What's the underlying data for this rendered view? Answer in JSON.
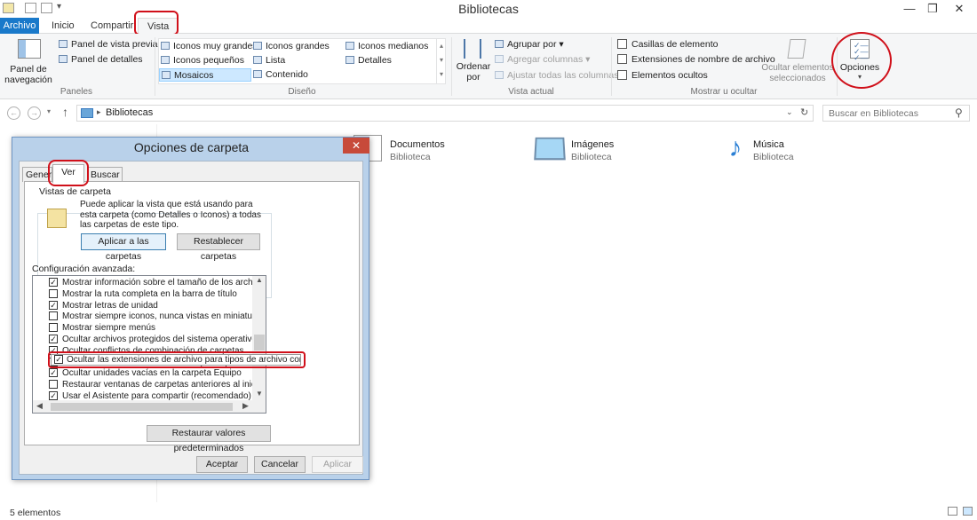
{
  "window": {
    "title": "Bibliotecas",
    "minimize": "—",
    "maximize": "❐",
    "close": "✕"
  },
  "tabs": [
    "Archivo",
    "Inicio",
    "Compartir",
    "Vista"
  ],
  "ribbon": {
    "panes": {
      "nav_pane": "Panel de navegación",
      "preview": "Panel de vista previa",
      "details": "Panel de detalles",
      "label": "Paneles"
    },
    "layout": {
      "items": [
        "Iconos muy grandes",
        "Iconos grandes",
        "Iconos medianos",
        "Iconos pequeños",
        "Lista",
        "Detalles",
        "Mosaicos",
        "Contenido"
      ],
      "label": "Diseño"
    },
    "current_view": {
      "sort_by": "Ordenar por",
      "group_by": "Agrupar por",
      "add_columns": "Agregar columnas",
      "fit_columns": "Ajustar todas las columnas",
      "label": "Vista actual"
    },
    "show_hide": {
      "item_checkboxes": "Casillas de elemento",
      "file_extensions": "Extensiones de nombre de archivo",
      "hidden_items": "Elementos ocultos",
      "hide_selected": "Ocultar elementos seleccionados",
      "label": "Mostrar u ocultar"
    },
    "options": "Opciones"
  },
  "address": {
    "path": "Bibliotecas",
    "search_placeholder": "Buscar en Bibliotecas"
  },
  "libraries": [
    {
      "name": "Documentos",
      "sub": "Biblioteca"
    },
    {
      "name": "Imágenes",
      "sub": "Biblioteca"
    },
    {
      "name": "Música",
      "sub": "Biblioteca"
    }
  ],
  "status": "5 elementos",
  "dialog": {
    "title": "Opciones de carpeta",
    "close": "✕",
    "tabs": [
      "General",
      "Ver",
      "Buscar"
    ],
    "folder_views": {
      "legend": "Vistas de carpeta",
      "description": "Puede aplicar la vista que está usando para esta carpeta (como Detalles o Iconos) a todas las carpetas de este tipo.",
      "apply": "Aplicar a las carpetas",
      "reset": "Restablecer carpetas"
    },
    "advanced_label": "Configuración avanzada:",
    "settings": [
      {
        "text": "Mostrar información sobre el tamaño de los archivos en su",
        "checked": true
      },
      {
        "text": "Mostrar la ruta completa en la barra de título",
        "checked": false
      },
      {
        "text": "Mostrar letras de unidad",
        "checked": true
      },
      {
        "text": "Mostrar siempre iconos, nunca vistas en miniatura",
        "checked": false
      },
      {
        "text": "Mostrar siempre menús",
        "checked": false
      },
      {
        "text": "Ocultar archivos protegidos del sistema operativo (recome",
        "checked": true
      },
      {
        "text": "Ocultar conflictos de combinación de carpetas",
        "checked": true
      },
      {
        "text": "Ocultar las extensiones de archivo para tipos de archivo conocidos",
        "checked": true
      },
      {
        "text": "Ocultar unidades vacías en la carpeta Equipo",
        "checked": true
      },
      {
        "text": "Restaurar ventanas de carpetas anteriores al iniciar sesió",
        "checked": false
      },
      {
        "text": "Usar el Asistente para compartir (recomendado)",
        "checked": true
      }
    ],
    "restore_defaults": "Restaurar valores predeterminados",
    "ok": "Aceptar",
    "cancel": "Cancelar",
    "apply": "Aplicar"
  },
  "colors": {
    "accent": "#1979ca",
    "highlight": "#d0101a"
  }
}
